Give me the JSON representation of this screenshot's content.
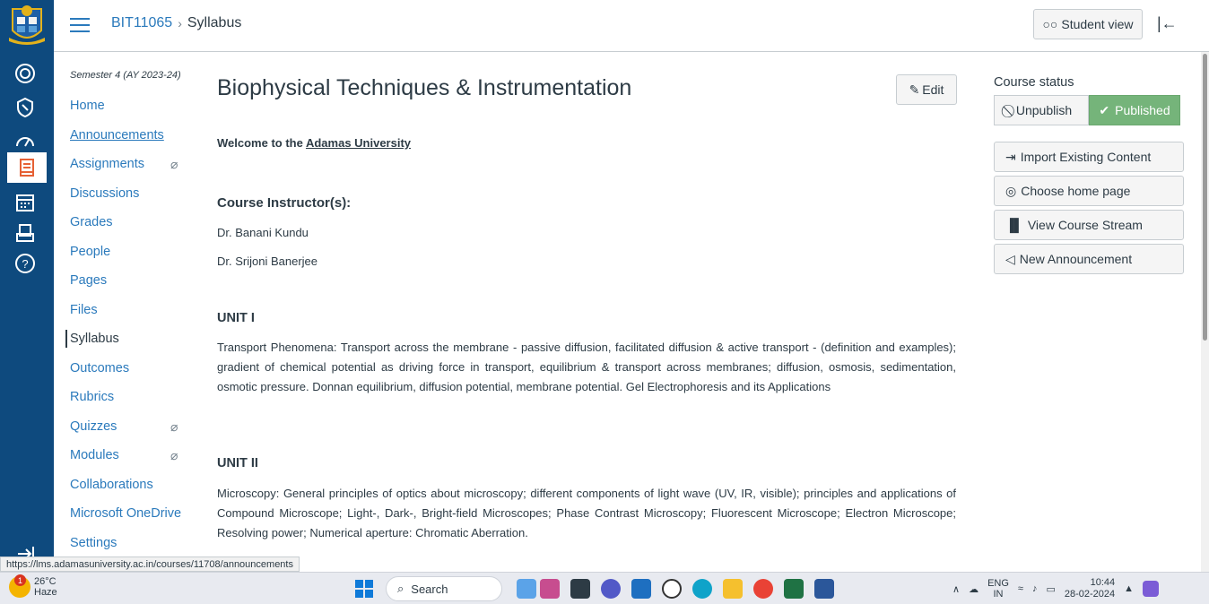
{
  "header": {
    "course_code": "BIT11065",
    "separator": "›",
    "current_page": "Syllabus",
    "student_view_label": "Student view"
  },
  "course_nav": {
    "term": "Semester 4 (AY 2023-24)",
    "items": [
      {
        "label": "Home"
      },
      {
        "label": "Announcements"
      },
      {
        "label": "Assignments"
      },
      {
        "label": "Discussions"
      },
      {
        "label": "Grades"
      },
      {
        "label": "People"
      },
      {
        "label": "Pages"
      },
      {
        "label": "Files"
      },
      {
        "label": "Syllabus"
      },
      {
        "label": "Outcomes"
      },
      {
        "label": "Rubrics"
      },
      {
        "label": "Quizzes"
      },
      {
        "label": "Modules"
      },
      {
        "label": "Collaborations"
      },
      {
        "label": "Microsoft OneDrive"
      },
      {
        "label": "Settings"
      }
    ]
  },
  "main": {
    "title": "Biophysical Techniques & Instrumentation",
    "edit_label": "Edit",
    "welcome_prefix": "Welcome to the ",
    "welcome_link": "Adamas University",
    "instructor_heading": "Course Instructor(s):",
    "instructors": [
      "Dr. Banani Kundu",
      "Dr. Srijoni Banerjee"
    ],
    "units": [
      {
        "heading": "UNIT I",
        "text": "Transport Phenomena: Transport across the membrane - passive diffusion, facilitated diffusion & active transport - (definition and examples); gradient of chemical potential as driving force in transport, equilibrium & transport across membranes; diffusion, osmosis, sedimentation, osmotic pressure. Donnan equilibrium, diffusion potential, membrane potential. Gel Electrophoresis and its Applications"
      },
      {
        "heading": "UNIT II",
        "text": "Microscopy: General principles of optics about microscopy; different components of light wave (UV, IR, visible); principles and applications of Compound Microscope; Light-, Dark-, Bright-field Microscopes; Phase Contrast Microscopy; Fluorescent Microscope; Electron Microscope; Resolving power; Numerical aperture: Chromatic Aberration."
      }
    ]
  },
  "sidebar": {
    "status_heading": "Course status",
    "unpublish_label": "Unpublish",
    "published_label": "Published",
    "buttons": [
      {
        "label": "Import Existing Content"
      },
      {
        "label": "Choose home page"
      },
      {
        "label": "View Course Stream"
      },
      {
        "label": "New Announcement"
      }
    ]
  },
  "status_url": "https://lms.adamasuniversity.ac.in/courses/11708/announcements",
  "taskbar": {
    "temperature": "26°C",
    "weather": "Haze",
    "weather_badge": "1",
    "search_label": "Search",
    "lang": "ENG",
    "region": "IN",
    "time": "10:44",
    "date": "28-02-2024"
  },
  "colors": {
    "nav_bg": "#0e4a7e",
    "link": "#2b7abc",
    "published_green": "#75b47a"
  }
}
